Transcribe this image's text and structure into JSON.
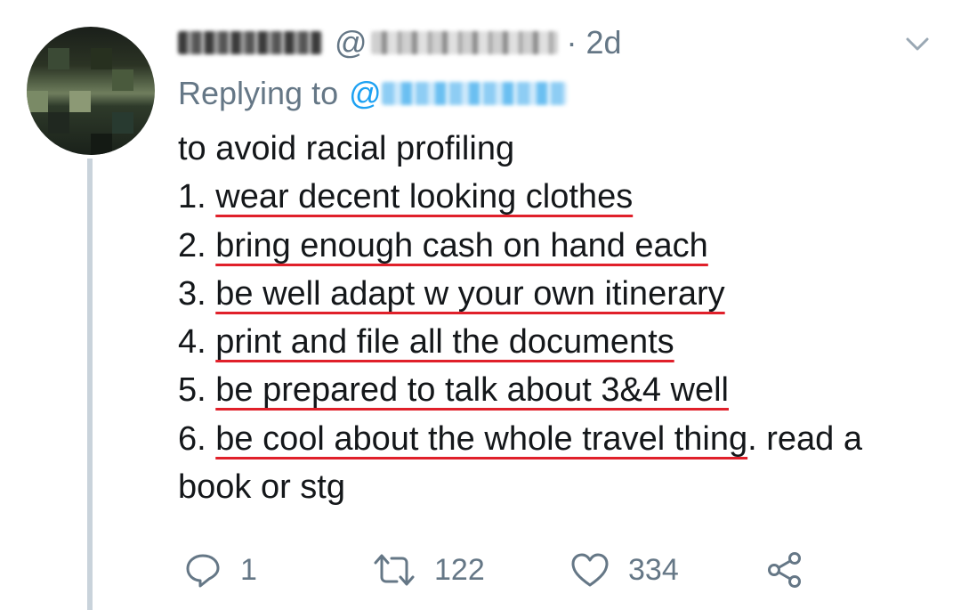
{
  "tweet": {
    "timestamp": "· 2d",
    "handle_prefix": "@",
    "replying_to_label": "Replying to",
    "reply_mention_prefix": "@",
    "lines": [
      {
        "prefix": "",
        "underlined": "",
        "text": "to avoid racial profiling",
        "suffix": ""
      },
      {
        "prefix": "1. ",
        "underlined": "wear decent looking clothes",
        "suffix": ""
      },
      {
        "prefix": "2. ",
        "underlined": "bring enough cash on hand each",
        "suffix": ""
      },
      {
        "prefix": "3. ",
        "underlined": "be well adapt w your own itinerary",
        "suffix": ""
      },
      {
        "prefix": "4. ",
        "underlined": "print and file all the documents",
        "suffix": ""
      },
      {
        "prefix": "5. ",
        "underlined": "be prepared to talk about 3&4 well",
        "suffix": ""
      },
      {
        "prefix": "6. ",
        "underlined": "be cool about the whole travel thing",
        "suffix": ". read a"
      },
      {
        "prefix": "",
        "underlined": "",
        "text": "book or stg",
        "suffix": ""
      }
    ]
  },
  "actions": {
    "reply_count": "1",
    "retweet_count": "122",
    "like_count": "334"
  },
  "icons": [
    "avatar",
    "chevron-down-icon",
    "reply-icon",
    "retweet-icon",
    "like-icon",
    "share-icon"
  ],
  "colors": {
    "text": "#14171a",
    "secondary": "#657786",
    "link": "#1da1f2",
    "underline": "#e0202a",
    "thread_line": "#c9d3db"
  }
}
